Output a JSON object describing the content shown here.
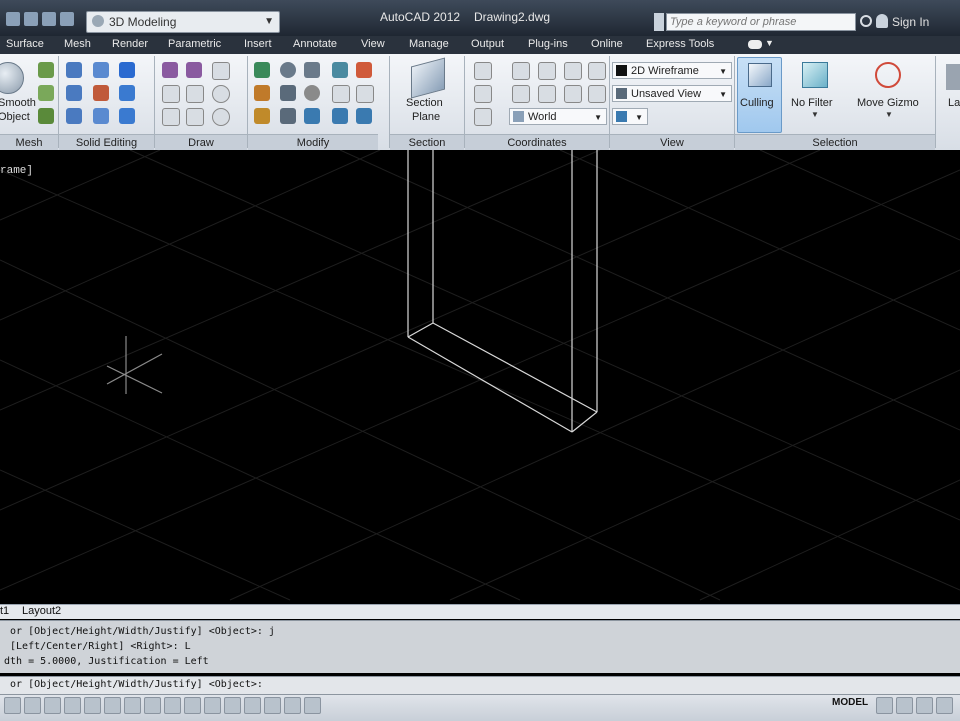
{
  "titlebar": {
    "workspace": "3D Modeling",
    "app_title": "AutoCAD 2012",
    "drawing_name": "Drawing2.dwg",
    "search_placeholder": "Type a keyword or phrase",
    "signin": "Sign In"
  },
  "tabs": [
    "Surface",
    "Mesh",
    "Render",
    "Parametric",
    "Insert",
    "Annotate",
    "View",
    "Manage",
    "Output",
    "Plug-ins",
    "Online",
    "Express Tools"
  ],
  "ribbon": {
    "panels": [
      "Mesh",
      "Solid Editing",
      "Draw",
      "Modify",
      "Section",
      "Coordinates",
      "View",
      "Selection"
    ],
    "smooth_object_label_1": "Smooth",
    "smooth_object_label_2": "Object",
    "section_plane_label_1": "Section",
    "section_plane_label_2": "Plane",
    "visual_style": "2D Wireframe",
    "named_view": "Unsaved View",
    "ucs": "World",
    "culling": "Culling",
    "no_filter": "No Filter",
    "move_gizmo": "Move Gizmo",
    "layers_partial": "La"
  },
  "viewport": {
    "label": "rame]"
  },
  "layout_tabs": [
    "t1",
    "Layout2"
  ],
  "command": {
    "history": [
      " or [Object/Height/Width/Justify] <Object>: j",
      " [Left/Center/Right] <Right>: L",
      "dth = 5.0000, Justification = Left"
    ],
    "prompt": " or [Object/Height/Width/Justify] <Object>:"
  },
  "status": {
    "model": "MODEL"
  }
}
